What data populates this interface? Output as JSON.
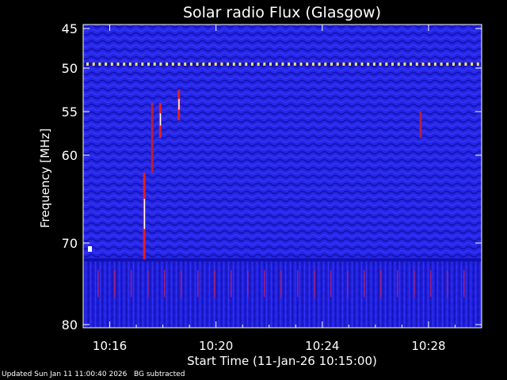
{
  "chart_data": {
    "type": "heatmap",
    "title": "Solar radio Flux (Glasgow)",
    "xlabel": "Start Time (11-Jan-26 10:15:00)",
    "ylabel": "Frequency [MHz]",
    "x_ticks": [
      "10:16",
      "10:20",
      "10:24",
      "10:28"
    ],
    "x_tick_minutes": [
      1,
      5,
      9,
      13
    ],
    "xlim_minutes": [
      0,
      15
    ],
    "y_ticks": [
      45,
      50,
      55,
      60,
      70,
      80
    ],
    "ylim": [
      45,
      80
    ],
    "interference_line_mhz": 49.5,
    "interference_spike_mhz": 71,
    "colors": {
      "background": "#2020e0",
      "dark_band": "#1010b0",
      "burst": "#e02020",
      "hot": "#ffe060",
      "axis": "#ffffff"
    },
    "bursts": [
      {
        "time_min": 2.3,
        "f_start": 62,
        "f_end": 72,
        "intensity": "high"
      },
      {
        "time_min": 2.6,
        "f_start": 54,
        "f_end": 62,
        "intensity": "medium"
      },
      {
        "time_min": 2.9,
        "f_start": 54,
        "f_end": 58,
        "intensity": "high"
      },
      {
        "time_min": 3.6,
        "f_start": 52.5,
        "f_end": 56,
        "intensity": "high"
      },
      {
        "time_min": 12.7,
        "f_start": 55,
        "f_end": 58,
        "intensity": "low"
      }
    ]
  },
  "footer": {
    "updated": "Updated Sun Jan 11 11:00:40 2026",
    "note": "BG subtracted"
  }
}
